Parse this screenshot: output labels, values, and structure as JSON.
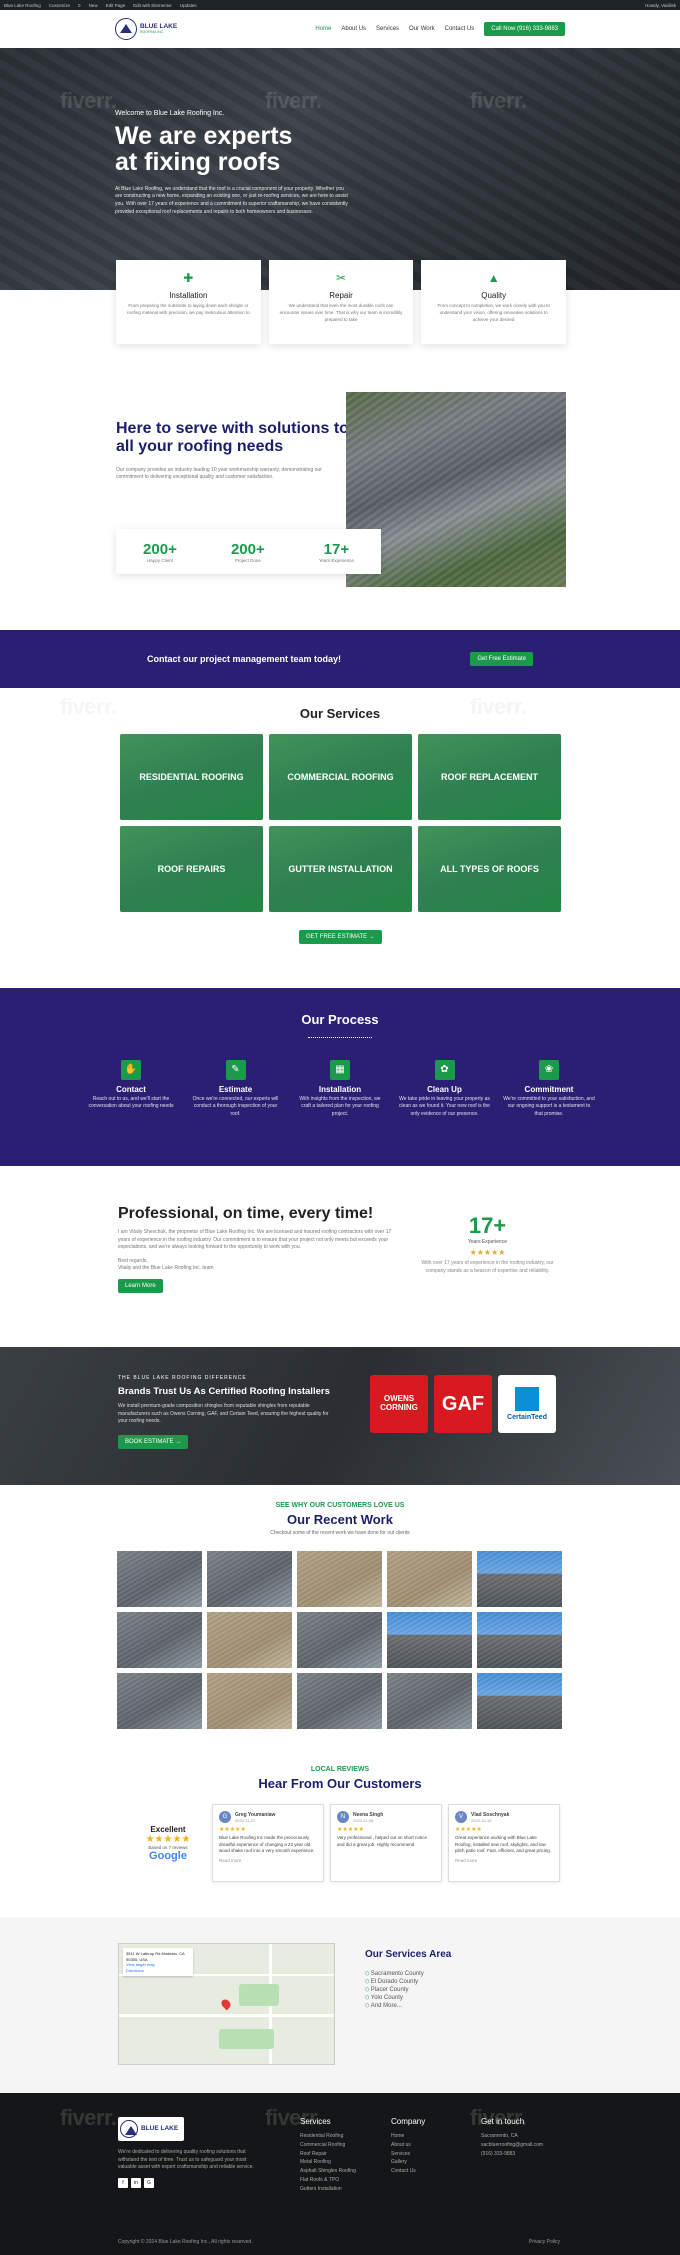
{
  "admin_bar": {
    "items": [
      "Blue Lake Roofing",
      "Customize",
      "0",
      "New",
      "Edit Page",
      "Edit with Elementor",
      "Updates"
    ],
    "greeting": "Howdy, Vasilisk"
  },
  "header": {
    "logo_title": "BLUE LAKE",
    "logo_subtitle": "ROOFING INC",
    "nav": [
      "Home",
      "About Us",
      "Services",
      "Our Work",
      "Contact Us"
    ],
    "call_label": "Call Now (916) 333-9883"
  },
  "hero": {
    "kicker": "Welcome to Blue Lake Roofing Inc.",
    "title": "We are experts at fixing roofs",
    "text": "At Blue Lake Roofing, we understand that the roof is a crucial component of your property. Whether you are constructing a new home, expanding an existing one, or just re-roofing services, we are here to assist you. With over 17 years of experience and a commitment to superior craftsmanship, we have consistently provided exceptional roof replacements and repairs to both homeowners and businesses."
  },
  "features": [
    {
      "icon": "puzzle-icon",
      "title": "Installation",
      "text": "From preparing the substrate to laying down each shingle or roofing material with precision, we pay meticulous attention to"
    },
    {
      "icon": "tools-icon",
      "title": "Repair",
      "text": "We understand that even the most durable roofs can encounter issues over time. That is why our team is incredibly prepared to take"
    },
    {
      "icon": "shapes-icon",
      "title": "Quality",
      "text": "From concept to completion, we work closely with you to understand your vision, offering innovative solutions to achieve your desired"
    }
  ],
  "about": {
    "title": "Here to serve with solutions to all your roofing needs",
    "text": "Our company provides an industry leading 10 year workmanship warranty, demonstrating our commitment to delivering exceptional quality and customer satisfaction.",
    "stats": [
      {
        "value": "200+",
        "label": "Happy Client"
      },
      {
        "value": "200+",
        "label": "Project Done"
      },
      {
        "value": "17+",
        "label": "Years Experience"
      }
    ]
  },
  "cta": {
    "text": "Contact our project management team today!",
    "button": "Get Free Estimate"
  },
  "services": {
    "title": "Our Services",
    "items": [
      "RESIDENTIAL ROOFING",
      "COMMERCIAL ROOFING",
      "ROOF REPLACEMENT",
      "ROOF REPAIRS",
      "GUTTER INSTALLATION",
      "ALL TYPES OF ROOFS"
    ],
    "button": "GET FREE ESTIMATE →"
  },
  "process": {
    "title": "Our Process",
    "steps": [
      {
        "icon": "handshake-icon",
        "title": "Contact",
        "text": "Reach out to us, and we'll start the conversation about your roofing needs"
      },
      {
        "icon": "estimate-icon",
        "title": "Estimate",
        "text": "Once we're connected, our experts will conduct a thorough inspection of your roof."
      },
      {
        "icon": "grid-icon",
        "title": "Installation",
        "text": "With insights from the inspection, we craft a tailored plan for your roofing project."
      },
      {
        "icon": "cleanup-icon",
        "title": "Clean Up",
        "text": "We take pride in leaving your property as clean as we found it. Your new roof is the only evidence of our presence."
      },
      {
        "icon": "commitment-icon",
        "title": "Commitment",
        "text": "We're committed to your satisfaction, and our ongoing support is a testament to that promise."
      }
    ]
  },
  "professional": {
    "title": "Professional, on time, every time!",
    "text": "I am Vitaliy Shevchuk, the proprietor of Blue Lake Roofing Inc. We are licensed and insured roofing contractors with over 17 years of experience in the roofing industry. Our commitment is to ensure that your project not only meets but exceeds your expectations, and we're always looking forward to the opportunity to work with you.",
    "regards": "Best regards,",
    "signature": "Vitaliy and the Blue Lake Roofing Inc. team",
    "button": "Learn More",
    "years": "17+",
    "years_label": "Years Experience",
    "years_text": "With over 17 years of experience in the roofing industry, our company stands as a beacon of expertise and reliability."
  },
  "certified": {
    "kicker": "THE BLUE LAKE ROOFING DIFFERENCE",
    "title": "Brands Trust Us As Certified Roofing Installers",
    "text": "We install premium-grade composition shingles from reputable shingles from reputable manufacturers such as Owens Corning, GAF, and Certain Teed, ensuring the highest quality for your roofing needs.",
    "button": "BOOK ESTIMATE →",
    "logos": [
      "OWENS CORNING",
      "GAF",
      "CertainTeed"
    ]
  },
  "work": {
    "kicker": "SEE WHY OUR CUSTOMERS LOVE US",
    "title": "Our Recent Work",
    "subtitle": "Checkout some of the recent work we have done for out clients"
  },
  "reviews": {
    "kicker": "LOCAL REVIEWS",
    "title": "Hear From Our Customers",
    "summary_label": "Excellent",
    "summary_based": "Based on 7 reviews",
    "summary_brand": "Google",
    "items": [
      {
        "initial": "G",
        "name": "Greg Youmaniaw",
        "date": "2023-11-27",
        "text": "Blue Lake Roofing Inc made the precociously dreadful experience of changing a 23 year old wood shake roof into a very smooth experience.",
        "more": "Read more"
      },
      {
        "initial": "N",
        "name": "Neena Singh",
        "date": "2023-11-08",
        "text": "Very professional , helped out on short notice and did a great job. Highly recommend",
        "more": ""
      },
      {
        "initial": "V",
        "name": "Vlad Soschnyak",
        "date": "2023-10-15",
        "text": "Great experience working with Blue Lake Roofing, installed new roof, skylights, and low pitch patio roof. Fast, efficient, and great pricing.",
        "more": "Read more"
      }
    ]
  },
  "service_area": {
    "title": "Our Services Area",
    "items": [
      "Sacramento County",
      "El Dorado County",
      "Placer County",
      "Yolo County",
      "And More..."
    ],
    "map_address": "3511 W Lathrop Rd Modesto, CA 95355, USA",
    "map_link": "View larger map",
    "map_directions": "Directions"
  },
  "footer": {
    "logo": "BLUE LAKE",
    "desc": "We're dedicated to delivering quality roofing solutions that withstand the test of time. Trust us to safeguard your most valuable asset with expert craftsmanship and reliable service.",
    "social": [
      "f",
      "in",
      "G"
    ],
    "services_title": "Services",
    "services": [
      "Residential Roofing",
      "Commercial Roofing",
      "Roof Repair",
      "Metal Roofing",
      "Asphalt Shingles Roofing",
      "Flat Roofs & TPO",
      "Gutters Installation"
    ],
    "company_title": "Company",
    "company": [
      "Home",
      "About us",
      "Services",
      "Gallery",
      "Contact Us"
    ],
    "contact_title": "Get in touch",
    "contact": [
      "Sacramento, CA",
      "sacbluerroofing@gmail.com",
      "(916) 333-9883"
    ],
    "copyright": "Copyright © 2024 Blue Lake Roofing Inc., All rights reserved.",
    "privacy": "Privacy Policy"
  },
  "colors": {
    "green": "#1b9a4b",
    "navy": "#2a1f73",
    "title_blue": "#1b1f6b"
  }
}
